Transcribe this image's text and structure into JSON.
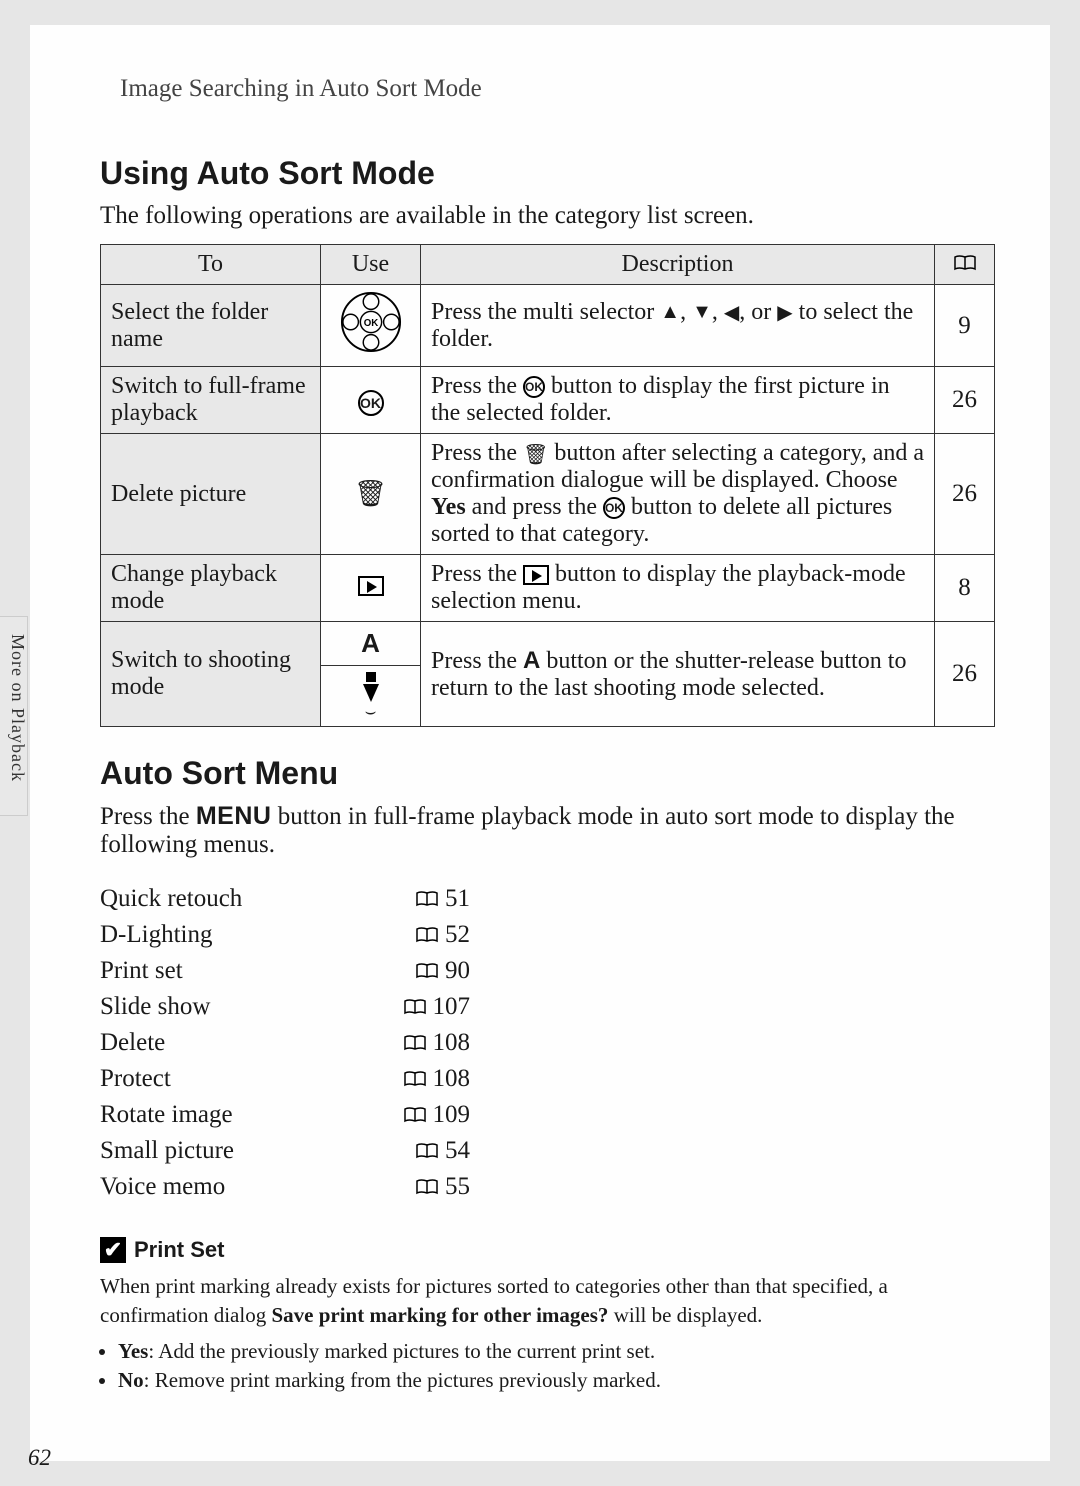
{
  "breadcrumb": "Image Searching in Auto Sort Mode",
  "section1_title": "Using Auto Sort Mode",
  "section1_intro": "The following operations are available in the category list screen.",
  "table": {
    "headers": {
      "c1": "To",
      "c2": "Use",
      "c3": "Description",
      "c4_icon": "book"
    },
    "rows": {
      "r0": {
        "to": "Select the folder name",
        "page": "9"
      },
      "r1": {
        "to": "Switch to full-frame playback",
        "page": "26"
      },
      "r2": {
        "to": "Delete picture",
        "page": "26"
      },
      "r3": {
        "to": "Change playback mode",
        "page": "8"
      },
      "r4": {
        "to": "Switch to shooting mode",
        "page": "26",
        "use_a": "A"
      }
    },
    "desc": {
      "r0_a": "Press the multi selector ",
      "r0_b": " to select the folder.",
      "r1_a": "Press the ",
      "r1_b": " button to display the first picture in the selected folder.",
      "r2_a": "Press the ",
      "r2_b": " button after selecting a category, and a confirmation dialogue will be displayed. Choose ",
      "r2_yes": "Yes",
      "r2_c": " and press the ",
      "r2_d": " button to delete all pictures sorted to that category.",
      "r3_a": "Press the ",
      "r3_b": " button to display the playback-mode selection menu.",
      "r4_a": "Press the ",
      "r4_A": "A",
      "r4_b": " button or the shutter-release button to return to the last shooting mode selected."
    }
  },
  "section2_title": "Auto Sort Menu",
  "section2_intro_a": "Press the ",
  "section2_intro_menu": "MENU",
  "section2_intro_b": " button in full-frame playback mode in auto sort mode to display the following menus.",
  "menu_items": {
    "i0": {
      "label": "Quick retouch",
      "page": "51"
    },
    "i1": {
      "label": "D-Lighting",
      "page": "52"
    },
    "i2": {
      "label": "Print set",
      "page": "90"
    },
    "i3": {
      "label": "Slide show",
      "page": "107"
    },
    "i4": {
      "label": "Delete",
      "page": "108"
    },
    "i5": {
      "label": "Protect",
      "page": "108"
    },
    "i6": {
      "label": "Rotate image",
      "page": "109"
    },
    "i7": {
      "label": "Small picture",
      "page": "54"
    },
    "i8": {
      "label": "Voice memo",
      "page": "55"
    }
  },
  "note": {
    "title": "Print Set",
    "body_a": "When print marking already exists for pictures sorted to categories other than that specified, a confirmation dialog ",
    "body_bold": "Save print marking for other images?",
    "body_b": " will be displayed.",
    "yes_label": "Yes",
    "yes_text": ": Add the previously marked pictures to the current print set.",
    "no_label": "No",
    "no_text": ": Remove print marking from the pictures previously marked."
  },
  "side_label": "More on Playback",
  "page_number": "62"
}
